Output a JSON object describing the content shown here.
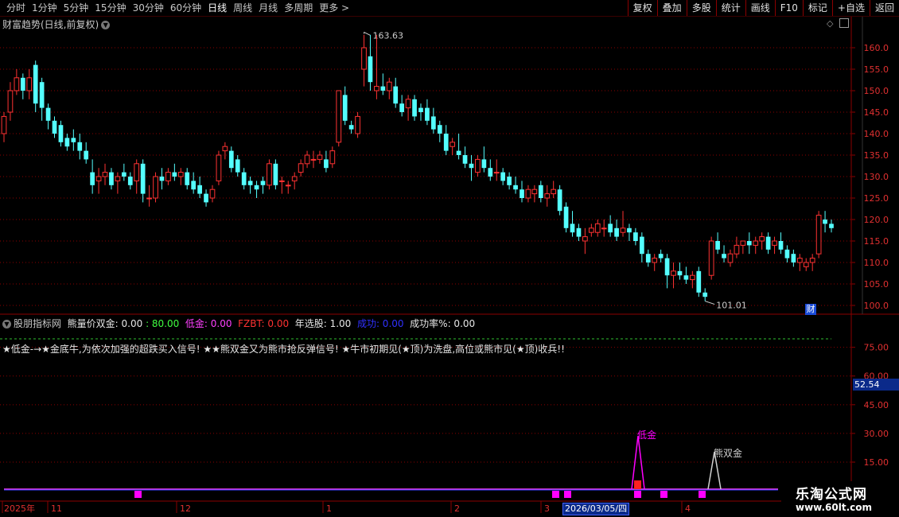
{
  "toolbar": {
    "timeframes": [
      "分时",
      "1分钟",
      "5分钟",
      "15分钟",
      "30分钟",
      "60分钟",
      "日线",
      "周线",
      "月线",
      "多周期",
      "更多"
    ],
    "active_timeframe": "日线",
    "more_arrow": ">",
    "tools": [
      "复权",
      "叠加",
      "多股",
      "统计",
      "画线",
      "F10",
      "标记",
      "+自选",
      "返回"
    ]
  },
  "main_chart": {
    "title": "财富趋势(日线,前复权)",
    "high_label": "163.63",
    "low_label": "101.01",
    "badge": "财",
    "y_ticks": [
      "160.0",
      "155.0",
      "150.0",
      "145.0",
      "140.0",
      "135.0",
      "130.0",
      "125.0",
      "120.0",
      "115.0",
      "110.0",
      "105.0",
      "100.0"
    ]
  },
  "indicator": {
    "name": "股朋指标网",
    "formula": "熊量价双金: 0.00",
    "v80": ": 80.00",
    "digold": "低金: 0.00",
    "fzbt": "FZBT: 0.00",
    "nianxuan": "年选股: 1.00",
    "chenggong": "成功: 0.00",
    "rate": "成功率%: 0.00",
    "note": "★低金-→★金底牛,为依次加强的超跌买入信号! ★★熊双金又为熊市抢反弹信号! ★牛市初期见(★顶)为洗盘,高位或熊市见(★顶)收兵!!",
    "current_value": "52.54",
    "y_ticks": [
      "75.00",
      "60.00",
      "45.00",
      "30.00",
      "15.00"
    ],
    "marker_low_gold": "低金",
    "marker_bear_gold": "熊双金"
  },
  "x_axis": {
    "labels": [
      "2025年",
      "11",
      "12",
      "1",
      "2",
      "3",
      "4"
    ],
    "cursor_date": "2026/03/05/四"
  },
  "watermark": {
    "line1": "乐淘公式网",
    "line2": "www.60lt.com"
  },
  "colors": {
    "up": "#ff3232",
    "down": "#54ffff",
    "grid": "#8b0000",
    "magenta": "#ff00ff"
  },
  "chart_data": {
    "type": "candlestick",
    "title": "财富趋势(日线,前复权)",
    "ylim": [
      100,
      165
    ],
    "annotations": {
      "high": 163.63,
      "low": 101.01
    },
    "candles": [
      [
        140,
        145,
        138,
        144
      ],
      [
        145,
        152,
        143,
        150
      ],
      [
        150,
        155,
        149,
        153
      ],
      [
        153,
        154,
        148,
        150
      ],
      [
        150,
        155,
        148,
        153
      ],
      [
        156,
        157,
        145,
        147
      ],
      [
        152,
        153,
        143,
        146
      ],
      [
        146,
        147,
        141,
        143
      ],
      [
        143,
        144,
        139,
        140
      ],
      [
        142,
        143,
        137,
        138
      ],
      [
        139,
        140,
        136,
        137
      ],
      [
        139,
        141,
        136,
        138
      ],
      [
        138,
        140,
        134,
        136
      ],
      [
        136,
        138,
        133,
        134
      ],
      [
        131,
        134,
        126,
        128
      ],
      [
        129,
        132,
        126,
        130
      ],
      [
        130,
        133,
        128,
        131
      ],
      [
        131,
        132,
        127,
        128
      ],
      [
        129,
        131,
        126,
        130
      ],
      [
        131,
        133,
        129,
        130
      ],
      [
        130,
        131,
        127,
        128
      ],
      [
        129,
        134,
        126,
        133
      ],
      [
        133,
        134,
        124,
        126
      ],
      [
        125,
        128,
        123,
        125
      ],
      [
        125,
        131,
        124,
        130
      ],
      [
        130,
        132,
        127,
        129
      ],
      [
        129,
        132,
        128,
        131
      ],
      [
        131,
        133,
        129,
        130
      ],
      [
        130,
        132,
        128,
        131
      ],
      [
        131,
        132,
        127,
        128
      ],
      [
        129,
        131,
        126,
        127
      ],
      [
        128,
        130,
        125,
        126
      ],
      [
        126,
        127,
        123,
        124
      ],
      [
        125,
        128,
        124,
        127
      ],
      [
        129,
        136,
        128,
        135
      ],
      [
        136,
        138,
        134,
        137
      ],
      [
        136,
        137,
        131,
        132
      ],
      [
        134,
        135,
        130,
        131
      ],
      [
        131,
        132,
        127,
        128
      ],
      [
        129,
        130,
        126,
        128
      ],
      [
        128,
        129,
        125,
        127
      ],
      [
        129,
        130,
        126,
        128
      ],
      [
        128,
        134,
        127,
        133
      ],
      [
        133,
        134,
        127,
        128
      ],
      [
        129,
        130,
        126,
        129
      ],
      [
        128,
        129,
        126,
        128
      ],
      [
        129,
        131,
        127,
        130
      ],
      [
        131,
        134,
        130,
        133
      ],
      [
        133,
        136,
        132,
        135
      ],
      [
        134,
        136,
        132,
        134
      ],
      [
        134,
        136,
        133,
        135
      ],
      [
        134,
        136,
        131,
        132
      ],
      [
        133,
        137,
        132,
        136
      ],
      [
        138,
        150,
        137,
        150
      ],
      [
        149,
        151,
        142,
        143
      ],
      [
        142,
        143,
        140,
        141
      ],
      [
        140,
        145,
        139,
        144
      ],
      [
        155,
        163,
        151,
        160
      ],
      [
        158,
        163,
        150,
        152
      ],
      [
        150,
        163,
        148,
        151
      ],
      [
        151,
        154,
        149,
        150
      ],
      [
        150,
        153,
        148,
        152
      ],
      [
        151,
        153,
        146,
        147
      ],
      [
        147,
        149,
        144,
        145
      ],
      [
        146,
        149,
        143,
        148
      ],
      [
        148,
        149,
        143,
        144
      ],
      [
        146,
        147,
        143,
        145
      ],
      [
        146,
        148,
        142,
        143
      ],
      [
        144,
        146,
        140,
        141
      ],
      [
        142,
        143,
        138,
        140
      ],
      [
        140,
        142,
        135,
        136
      ],
      [
        137,
        139,
        135,
        138
      ],
      [
        136,
        140,
        134,
        135
      ],
      [
        135,
        137,
        132,
        133
      ],
      [
        133,
        135,
        129,
        132
      ],
      [
        131,
        135,
        130,
        134
      ],
      [
        134,
        137,
        131,
        132
      ],
      [
        132,
        134,
        129,
        130
      ],
      [
        131,
        134,
        129,
        131
      ],
      [
        131,
        132,
        128,
        129
      ],
      [
        130,
        131,
        127,
        128
      ],
      [
        128,
        130,
        126,
        127
      ],
      [
        127,
        129,
        124,
        125
      ],
      [
        125,
        128,
        124,
        127
      ],
      [
        126,
        128,
        124,
        127
      ],
      [
        128,
        129,
        124,
        125
      ],
      [
        125,
        128,
        123,
        126
      ],
      [
        126,
        129,
        125,
        127
      ],
      [
        127,
        128,
        121,
        122
      ],
      [
        123,
        124,
        117,
        118
      ],
      [
        119,
        122,
        116,
        117
      ],
      [
        118,
        119,
        115,
        116
      ],
      [
        115,
        118,
        112,
        116
      ],
      [
        117,
        119,
        116,
        118
      ],
      [
        117,
        120,
        116,
        119
      ],
      [
        118,
        120,
        116,
        118
      ],
      [
        119,
        121,
        116,
        117
      ],
      [
        118,
        120,
        115,
        116
      ],
      [
        117,
        122,
        116,
        118
      ],
      [
        118,
        119,
        115,
        117
      ],
      [
        117,
        118,
        114,
        115
      ],
      [
        116,
        117,
        110,
        112
      ],
      [
        112,
        113,
        109,
        110
      ],
      [
        110,
        112,
        108,
        111
      ],
      [
        112,
        113,
        110,
        111
      ],
      [
        111,
        112,
        104,
        107
      ],
      [
        107,
        110,
        104,
        108
      ],
      [
        108,
        110,
        106,
        107
      ],
      [
        107,
        109,
        105,
        106
      ],
      [
        106,
        108,
        104,
        107
      ],
      [
        108,
        109,
        102,
        103
      ],
      [
        103,
        104,
        101,
        102
      ],
      [
        107,
        116,
        106,
        115
      ],
      [
        115,
        117,
        112,
        113
      ],
      [
        112,
        114,
        110,
        111
      ],
      [
        110,
        113,
        109,
        112
      ],
      [
        112,
        116,
        111,
        114
      ],
      [
        114,
        115,
        112,
        115
      ],
      [
        115,
        117,
        112,
        114
      ],
      [
        114,
        116,
        112,
        115
      ],
      [
        115,
        117,
        113,
        116
      ],
      [
        116,
        117,
        112,
        113
      ],
      [
        114,
        116,
        112,
        115
      ],
      [
        115,
        117,
        112,
        113
      ],
      [
        113,
        114,
        110,
        111
      ],
      [
        112,
        113,
        109,
        110
      ],
      [
        110,
        112,
        108,
        111
      ],
      [
        109,
        111,
        108,
        110
      ],
      [
        110,
        112,
        108,
        111
      ],
      [
        112,
        122,
        111,
        121
      ],
      [
        120,
        122,
        117,
        119
      ],
      [
        119,
        120,
        117,
        118
      ]
    ]
  }
}
